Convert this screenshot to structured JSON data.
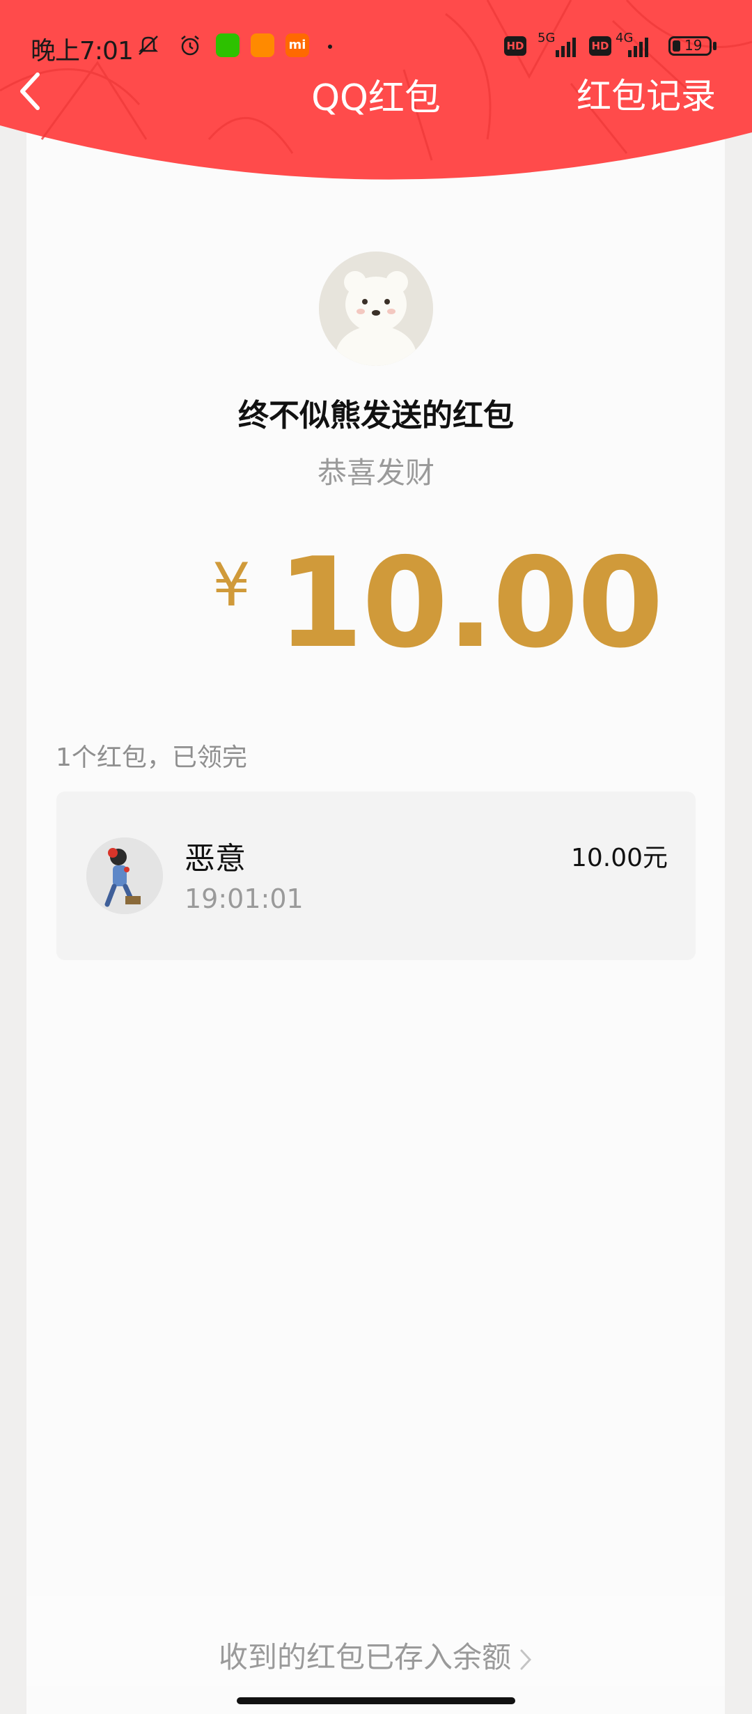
{
  "status_bar": {
    "time": "晚上7:01",
    "network_1": "5G",
    "network_2": "4G",
    "hd_label": "HD",
    "battery": "19",
    "mi_label": "mi"
  },
  "nav": {
    "title": "QQ红包",
    "records_label": "红包记录"
  },
  "sender": {
    "name": "终不似熊发送的红包",
    "greeting": "恭喜发财"
  },
  "amount": {
    "currency": "¥",
    "value": "10.00"
  },
  "summary": "1个红包，已领完",
  "records": [
    {
      "name": "恶意",
      "time": "19:01:01",
      "amount": "10.00元"
    }
  ],
  "footer": {
    "link_text": "收到的红包已存入余额"
  },
  "colors": {
    "header_red": "#ff4b4b",
    "gold": "#d09a3a"
  }
}
